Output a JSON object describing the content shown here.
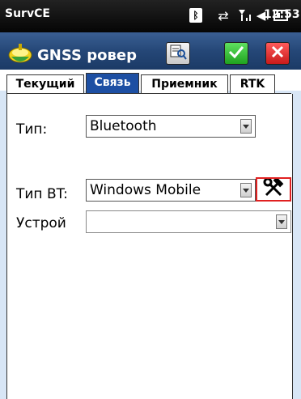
{
  "status_bar": {
    "app_name": "SurvCE",
    "time": "12:53",
    "icons": [
      "bluetooth-icon",
      "sync-icon",
      "signal-icon",
      "volume-icon",
      "battery-icon"
    ]
  },
  "title_bar": {
    "title": "GNSS ровер",
    "buttons": [
      "receiver-utility-icon",
      "ok-check-icon",
      "cancel-x-icon"
    ]
  },
  "tabs": [
    {
      "label": "Текущий",
      "active": false
    },
    {
      "label": "Связь",
      "active": true
    },
    {
      "label": "Приемник",
      "active": false
    },
    {
      "label": "RTK",
      "active": false
    }
  ],
  "form": {
    "type_label": "Тип:",
    "type_value": "Bluetooth",
    "bt_type_label": "Тип BT:",
    "bt_type_value": "Windows Mobile",
    "device_label": "Устрой",
    "device_value": ""
  },
  "colors": {
    "title_bar": "#254777",
    "active_tab": "#1d4fa3",
    "ok_button": "#2fb52f",
    "cancel_button": "#e02424",
    "highlight_border": "#e02020"
  }
}
